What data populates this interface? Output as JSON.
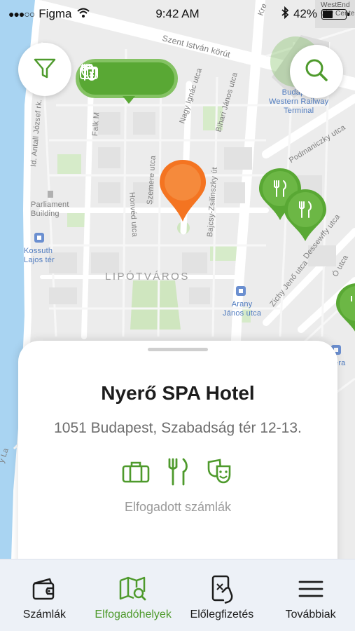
{
  "status_bar": {
    "carrier": "Figma",
    "time": "9:42 AM",
    "battery": "42%",
    "battery_level": 0.42,
    "signal": "●●●○○"
  },
  "map": {
    "labels": {
      "szent_istvan": "Szent István körút",
      "falk": "Falk M",
      "nagy_ignac": "Nagy Ignác utca",
      "bihari": "Bihari János utca",
      "honved": "Honvéd utca",
      "szemere": "Szemere utca",
      "id_antall": "Id. Antall József rk.",
      "parliament": "Parliament\nBuilding",
      "kossuth": "Kossuth\nLajos tér",
      "lipotvaros": "LIPÓTVÁROS",
      "bajcsy": "Bajcsy-Zsilinszky út",
      "arany": "Arany\nJános utca",
      "zichy": "Zichy Jenő utca",
      "o_utca": "Ó utca",
      "dessewffy": "Dessewffy utca",
      "podmaniczky": "Podmaniczky utca",
      "western": "Budapest\nWestern Railway\nTerminal",
      "westend": "WestEnd\nCity Center",
      "kre": "Kre",
      "era": "era",
      "y_la": "y La"
    },
    "colors": {
      "brand_green": "#59a834",
      "pin_orange": "#f47421",
      "park_green": "#d6ebc9"
    }
  },
  "buttons": {
    "filter_icon": "filter-icon",
    "search_icon": "search-icon"
  },
  "map_pins": {
    "group_icons": [
      "theater-masks-icon",
      "cutlery-icon",
      "suitcase-icon"
    ],
    "single_icon": "cutlery-icon"
  },
  "sheet": {
    "title": "Nyerő SPA Hotel",
    "address": "1051 Budapest, Szabadság tér 12-13.",
    "accepted_label": "Elfogadott számlák",
    "accepted_icons": [
      "suitcase-icon",
      "cutlery-icon",
      "theater-masks-icon"
    ]
  },
  "tabs": [
    {
      "label": "Számlák",
      "icon": "wallet-icon",
      "active": false
    },
    {
      "label": "Elfogadóhelyek",
      "icon": "map-search-icon",
      "active": true
    },
    {
      "label": "Előlegfizetés",
      "icon": "phone-pay-icon",
      "active": false
    },
    {
      "label": "Továbbiak",
      "icon": "menu-icon",
      "active": false
    }
  ]
}
